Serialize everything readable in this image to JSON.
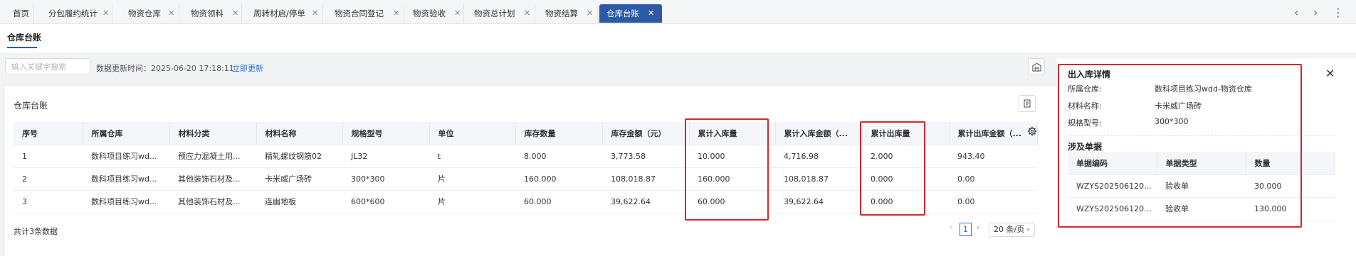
{
  "tabs": [
    {
      "label": "首页",
      "closable": false
    },
    {
      "label": "分包履约统计",
      "closable": true
    },
    {
      "label": "物资仓库",
      "closable": true
    },
    {
      "label": "物资领料",
      "closable": true
    },
    {
      "label": "周转材启/停单",
      "closable": true
    },
    {
      "label": "物资合同登记",
      "closable": true
    },
    {
      "label": "物资验收",
      "closable": true
    },
    {
      "label": "物资总计划",
      "closable": true
    },
    {
      "label": "物资结算",
      "closable": true
    },
    {
      "label": "仓库台账",
      "closable": true,
      "active": true
    }
  ],
  "tab_nav": {
    "prev": "‹",
    "next": "›",
    "more": "⋮"
  },
  "close_glyph": "✕",
  "page_title": "仓库台账",
  "search": {
    "placeholder": "输入关键字搜索",
    "value": ""
  },
  "update_time_text": "数据更新时间：2025-06-20 17:18:11",
  "update_link": "立即更新",
  "card_title": "仓库台账",
  "table": {
    "columns": [
      "序号",
      "所属仓库",
      "材料分类",
      "材料名称",
      "规格型号",
      "单位",
      "库存数量",
      "库存金额（元）",
      "累计入库量",
      "累计入库金额（...",
      "累计出库量",
      "累计出库金额（..."
    ],
    "rows": [
      [
        "1",
        "数科项目练习wd...",
        "预应力混凝土用...",
        "精轧螺纹钢筋02",
        "JL32",
        "t",
        "8.000",
        "3,773.58",
        "10.000",
        "4,716.98",
        "2.000",
        "943.40"
      ],
      [
        "2",
        "数科项目练习wd...",
        "其他装饰石材及...",
        "卡米威广场砖",
        "300*300",
        "片",
        "160.000",
        "108,018.87",
        "160.000",
        "108,018.87",
        "0.000",
        "0.00"
      ],
      [
        "3",
        "数科项目练习wd...",
        "其他装饰石材及...",
        "连幽地板",
        "600*600",
        "片",
        "60.000",
        "39,622.64",
        "60.000",
        "39,622.64",
        "0.000",
        "0.00"
      ]
    ],
    "link_columns": [
      8,
      10
    ]
  },
  "total_text": "共计3条数据",
  "pager": {
    "prev": "‹",
    "current": "1",
    "next": "›",
    "page_size": "20 条/页",
    "dropdown": "⌄"
  },
  "side": {
    "title": "出入库详情",
    "fields": [
      {
        "label": "所属仓库:",
        "value": "数科项目练习wdd-物资仓库"
      },
      {
        "label": "材料名称:",
        "value": "卡米威广场砖"
      },
      {
        "label": "规格型号:",
        "value": "300*300"
      }
    ],
    "docs_title": "涉及单据",
    "doc_columns": [
      "单据编码",
      "单据类型",
      "数量"
    ],
    "docs": [
      [
        "WZYS202506120...",
        "验收单",
        "30.000"
      ],
      [
        "WZYS202506120...",
        "验收单",
        "130.000"
      ]
    ]
  },
  "colors": {
    "accent": "#2d5aa6",
    "link": "#2d6be4",
    "highlight": "#d9262c"
  }
}
